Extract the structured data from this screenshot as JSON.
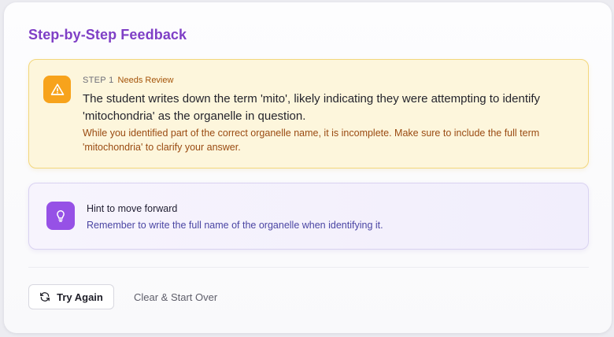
{
  "header": {
    "title": "Step-by-Step Feedback"
  },
  "step": {
    "label": "STEP 1",
    "status": "Needs Review",
    "description": "The student writes down the term 'mito', likely indicating they were attempting to identify 'mitochondria' as the organelle in question.",
    "feedback": "While you identified part of the correct organelle name, it is incomplete. Make sure to include the full term 'mitochondria' to clarify your answer.",
    "icon": "warning-icon",
    "accent": "#f7a31c"
  },
  "hint": {
    "title": "Hint to move forward",
    "text": "Remember to write the full name of the organelle when identifying it.",
    "icon": "lightbulb-icon",
    "accent": "#9651e6"
  },
  "actions": {
    "try_again_label": "Try Again",
    "try_again_icon": "refresh-icon",
    "clear_label": "Clear & Start Over"
  },
  "colors": {
    "title": "#7f3fc6",
    "warning_bg": "#fdf6dc",
    "warning_border": "#f3d77c",
    "hint_bg": "#f3f0fc",
    "hint_border": "#d9d2f1"
  }
}
